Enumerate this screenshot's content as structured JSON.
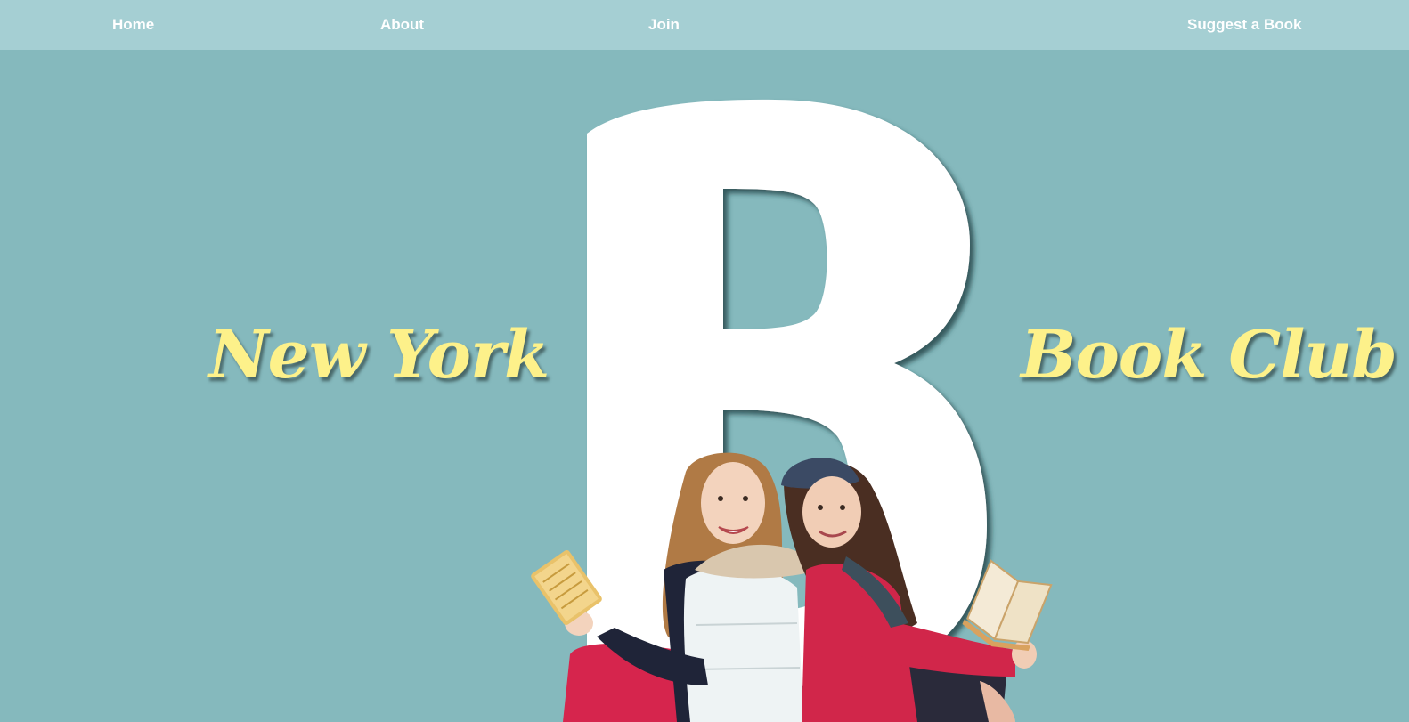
{
  "nav": {
    "home_label": "Home",
    "about_label": "About",
    "join_label": "Join",
    "suggest_label": "Suggest a Book"
  },
  "hero": {
    "big_letter": "B",
    "title_left": "New York",
    "title_right": "Book Club",
    "image": "two-girls-reading-books-photo"
  },
  "colors": {
    "background": "#85b9bd",
    "navbar": "#a5cfd3",
    "title_text": "#fdf18a",
    "nav_text": "#ffffff",
    "letter": "#ffffff"
  }
}
